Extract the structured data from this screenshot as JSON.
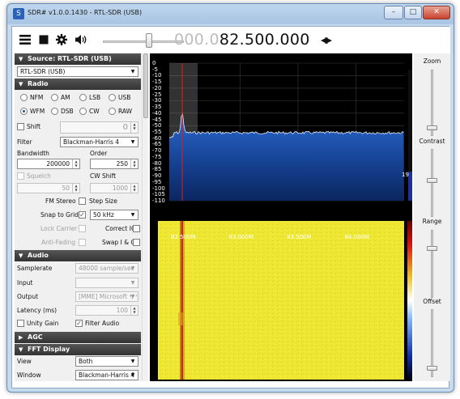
{
  "window": {
    "title": "SDR# v1.0.0.1430 - RTL-SDR (USB)",
    "minimize_glyph": "–",
    "maximize_glyph": "□",
    "close_glyph": "✕",
    "app_icon_glyph": "S"
  },
  "toolbar": {
    "menu_icon": "menu-icon",
    "stop_icon": "stop-icon",
    "settings_icon": "gear-icon",
    "volume_icon": "speaker-icon",
    "frequency_dim": "000.0",
    "frequency_lit": "82.500.000",
    "frequency_arrows": "◀▶",
    "volume_level": 0.57
  },
  "source": {
    "header": "Source: RTL-SDR (USB)",
    "device": "RTL-SDR (USB)"
  },
  "radio": {
    "header": "Radio",
    "modes": [
      "NFM",
      "AM",
      "LSB",
      "USB",
      "WFM",
      "DSB",
      "CW",
      "RAW"
    ],
    "selected_mode": "WFM",
    "shift_label": "Shift",
    "shift_value": "0",
    "filter_label": "Filter",
    "filter_value": "Blackman-Harris 4",
    "bandwidth_label": "Bandwidth",
    "bandwidth_value": "200000",
    "order_label": "Order",
    "order_value": "250",
    "squelch_label": "Squelch",
    "squelch_value": "50",
    "cw_shift_label": "CW Shift",
    "cw_shift_value": "1000",
    "fm_stereo_label": "FM Stereo",
    "step_size_label": "Step Size",
    "snap_label": "Snap to Grid",
    "snap_value": "50 kHz",
    "lock_carrier_label": "Lock Carrier",
    "correct_iq_label": "Correct IQ",
    "anti_fading_label": "Anti-Fading",
    "swap_iq_label": "Swap I & Q"
  },
  "audio": {
    "header": "Audio",
    "samplerate_label": "Samplerate",
    "samplerate_value": "48000 sample/sec",
    "input_label": "Input",
    "input_value": "",
    "output_label": "Output",
    "output_value": "[MME] Microsoft サウ",
    "latency_label": "Latency (ms)",
    "latency_value": "100",
    "unity_gain_label": "Unity Gain",
    "filter_audio_label": "Filter Audio"
  },
  "agc": {
    "header": "AGC"
  },
  "fft": {
    "header": "FFT Display",
    "view_label": "View",
    "view_value": "Both",
    "window_label": "Window",
    "window_value": "Blackman-Harris 4"
  },
  "display": {
    "y_ticks": [
      "0",
      "-5",
      "-10",
      "-15",
      "-20",
      "-25",
      "-30",
      "-35",
      "-40",
      "-45",
      "-50",
      "-55",
      "-60",
      "-65",
      "-70",
      "-75",
      "-80",
      "-85",
      "-90",
      "-95",
      "-100",
      "-105",
      "-110"
    ],
    "x_ticks": [
      "82.500M",
      "83.000M",
      "83.500M",
      "84.000M"
    ],
    "level_value": "19",
    "colors": {
      "spectrum_fill": "#1b4fa8",
      "waterfall_bg": "#efe833",
      "marker": "#e21c1c"
    }
  },
  "right_panel": {
    "zoom_label": "Zoom",
    "contrast_label": "Contrast",
    "range_label": "Range",
    "offset_label": "Offset"
  }
}
